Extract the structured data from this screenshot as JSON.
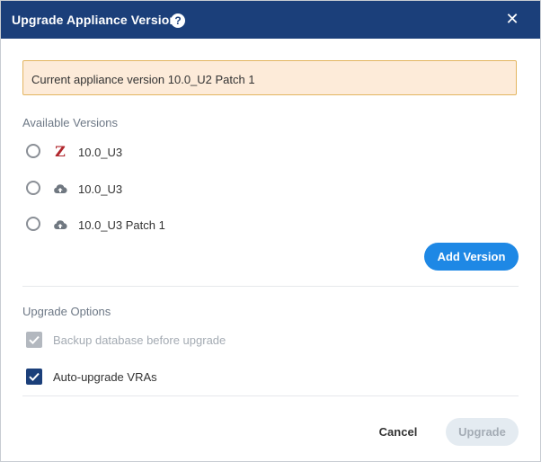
{
  "dialog": {
    "title": "Upgrade Appliance Version",
    "help_icon": "question-circle-icon",
    "close_icon": "close-icon"
  },
  "banner": {
    "text": "Current appliance version 10.0_U2 Patch 1"
  },
  "versions": {
    "label": "Available Versions",
    "items": [
      {
        "icon": "zerto-z-icon",
        "icon_glyph": "Z",
        "label": "10.0_U3",
        "selected": false
      },
      {
        "icon": "cloud-upload-icon",
        "label": "10.0_U3",
        "selected": false
      },
      {
        "icon": "cloud-upload-icon",
        "label": "10.0_U3 Patch 1",
        "selected": false
      }
    ],
    "add_button": "Add Version"
  },
  "options": {
    "label": "Upgrade Options",
    "items": [
      {
        "label": "Backup database before upgrade",
        "checked": true,
        "disabled": true
      },
      {
        "label": "Auto-upgrade VRAs",
        "checked": true,
        "disabled": false
      }
    ]
  },
  "footer": {
    "cancel": "Cancel",
    "upgrade": "Upgrade"
  },
  "colors": {
    "header_bg": "#1b3f7a",
    "banner_bg": "#fdebd9",
    "banner_border": "#e3b560",
    "primary_button": "#1e88e5",
    "checkbox_checked": "#1b3f7a",
    "checkbox_disabled": "#b3b8bf",
    "disabled_button_bg": "#e4ebf1"
  }
}
